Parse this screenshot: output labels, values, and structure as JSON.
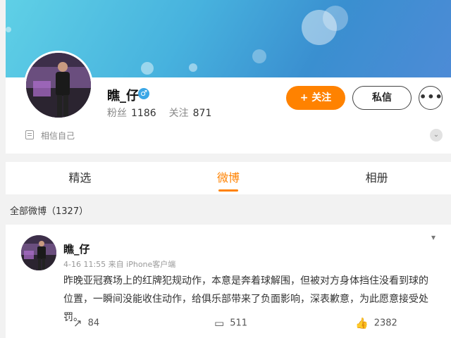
{
  "profile": {
    "name": "瞧_仔",
    "gender_icon": "male-icon",
    "fans_label": "粉丝",
    "fans_count": "1186",
    "follow_label": "关注",
    "follow_count": "871",
    "bio": "相信自己",
    "follow_button": "+ 关注",
    "message_button": "私信",
    "more_button": "•••"
  },
  "tabs": [
    {
      "label": "精选",
      "active": false
    },
    {
      "label": "微博",
      "active": true
    },
    {
      "label": "相册",
      "active": false
    }
  ],
  "feed": {
    "title": "全部微博（1327）"
  },
  "post": {
    "author": "瞧_仔",
    "meta": "4-16 11:55 来自 iPhone客户端",
    "text": "昨晚亚冠赛场上的红牌犯规动作，本意是奔着球解围，但被对方身体挡住没看到球的位置，一瞬间没能收住动作，给俱乐部带来了负面影响，深表歉意，为此愿意接受处罚。",
    "repost_count": "84",
    "comment_count": "511",
    "like_count": "2382"
  },
  "colors": {
    "accent": "#ff8200",
    "banner": "#47b2de"
  }
}
